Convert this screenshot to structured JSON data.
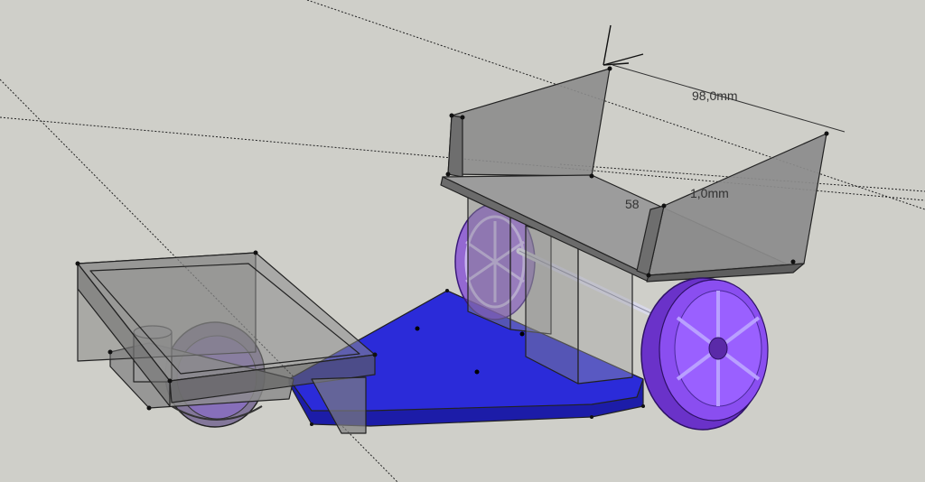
{
  "dimensions": [
    {
      "id": "width",
      "label": "98,0mm"
    },
    {
      "id": "thickness",
      "label": "1,0mm"
    },
    {
      "id": "partial",
      "label": "58"
    }
  ],
  "colors": {
    "background": "#cfcfc9",
    "base_plate": "#2b2bd9",
    "base_plate_side": "#1c1ca8",
    "translucent_part": "#6b6b6b",
    "wheel": "#7a3cd6"
  },
  "icons": [
    "axis-icon"
  ]
}
